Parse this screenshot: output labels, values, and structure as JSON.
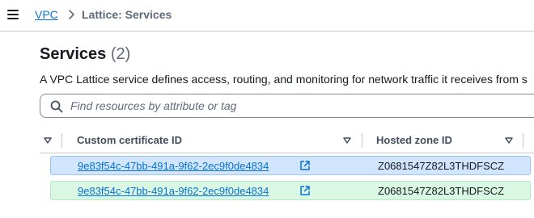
{
  "breadcrumb": {
    "items": [
      "VPC",
      "Lattice: Services"
    ]
  },
  "page": {
    "title": "Services",
    "count": "(2)",
    "description": "A VPC Lattice service defines access, routing, and monitoring for network traffic it receives from s"
  },
  "search": {
    "placeholder": "Find resources by attribute or tag",
    "value": ""
  },
  "table": {
    "columns": [
      "Custom certificate ID",
      "Hosted zone ID"
    ],
    "rows": [
      {
        "certificate_id": "9e83f54c-47bb-491a-9f62-2ec9f0de4834",
        "hosted_zone_id": "Z0681547Z82L3THDFSCZ"
      },
      {
        "certificate_id": "9e83f54c-47bb-491a-9f62-2ec9f0de4834",
        "hosted_zone_id": "Z0681547Z82L3THDFSCZ"
      }
    ]
  },
  "icons": [
    "menu-icon",
    "chevron-right-icon",
    "search-icon",
    "sort-caret-icon",
    "external-link-icon"
  ],
  "colors": {
    "link": "#0972d3",
    "row_selected": "#d1e5ff",
    "row_highlight": "#d9f7e2"
  }
}
